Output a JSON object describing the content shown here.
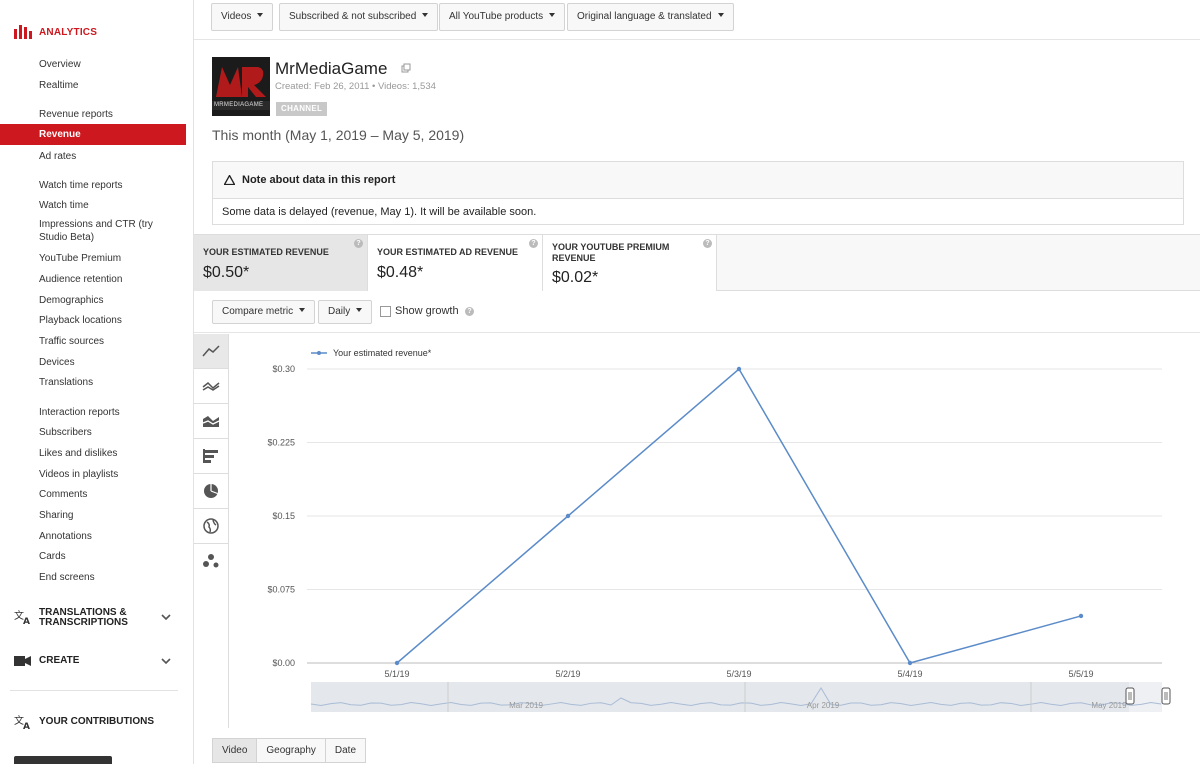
{
  "sidebar": {
    "brand": "ANALYTICS",
    "items": [
      {
        "label": "Overview",
        "top": 58
      },
      {
        "label": "Realtime",
        "top": 79
      }
    ],
    "groups": {
      "revenue_reports": "Revenue reports",
      "revenue": "Revenue",
      "ad_rates": "Ad rates",
      "watch_time_reports": "Watch time reports",
      "watch_time": "Watch time",
      "impressions_ctr": "Impressions and CTR (try Studio Beta)",
      "youtube_premium": "YouTube Premium",
      "audience_retention": "Audience retention",
      "demographics": "Demographics",
      "playback_locations": "Playback locations",
      "traffic_sources": "Traffic sources",
      "devices": "Devices",
      "translations": "Translations",
      "interaction_reports": "Interaction reports",
      "subscribers": "Subscribers",
      "likes_dislikes": "Likes and dislikes",
      "videos_in_playlists": "Videos in playlists",
      "comments": "Comments",
      "sharing": "Sharing",
      "annotations": "Annotations",
      "cards": "Cards",
      "end_screens": "End screens"
    },
    "translations_section": "TRANSLATIONS & TRANSCRIPTIONS",
    "create_section": "CREATE",
    "contributions_section": "YOUR CONTRIBUTIONS"
  },
  "filters": {
    "content": "Videos",
    "subscription": "Subscribed & not subscribed",
    "products": "All YouTube products",
    "language": "Original language & translated"
  },
  "channel": {
    "name": "MrMediaGame",
    "meta": "Created: Feb 26, 2011  •  Videos: 1,534",
    "badge": "CHANNEL",
    "thumb_text": "MRMEDIAGAME"
  },
  "date_range": "This month (May 1, 2019 – May 5, 2019)",
  "note": {
    "title": "Note about data in this report",
    "body": "Some data is delayed (revenue, May 1). It will be available soon."
  },
  "metrics": [
    {
      "label": "YOUR ESTIMATED REVENUE",
      "value": "$0.50*"
    },
    {
      "label": "YOUR ESTIMATED AD REVENUE",
      "value": "$0.48*"
    },
    {
      "label": "YOUR YOUTUBE PREMIUM REVENUE",
      "value": "$0.02*"
    }
  ],
  "controls": {
    "compare": "Compare metric",
    "interval": "Daily",
    "show_growth": "Show growth",
    "show_growth_checked": false
  },
  "bottom_tabs": [
    "Video",
    "Geography",
    "Date"
  ],
  "colors": {
    "accent": "#cc181e",
    "series": "#5b8bc9"
  },
  "chart_data": {
    "type": "line",
    "categories": [
      "5/1/19",
      "5/2/19",
      "5/3/19",
      "5/4/19",
      "5/5/19"
    ],
    "series": [
      {
        "name": "Your estimated revenue*",
        "values": [
          0.0,
          0.15,
          0.3,
          0.0,
          0.048
        ]
      }
    ],
    "yticks": [
      "$0.00",
      "$0.075",
      "$0.15",
      "$0.225",
      "$0.30"
    ],
    "ylim": [
      0,
      0.3
    ],
    "grid": true,
    "legend": "top-left",
    "navigator_labels": [
      "Mar 2019",
      "Apr 2019",
      "May 2019"
    ]
  }
}
